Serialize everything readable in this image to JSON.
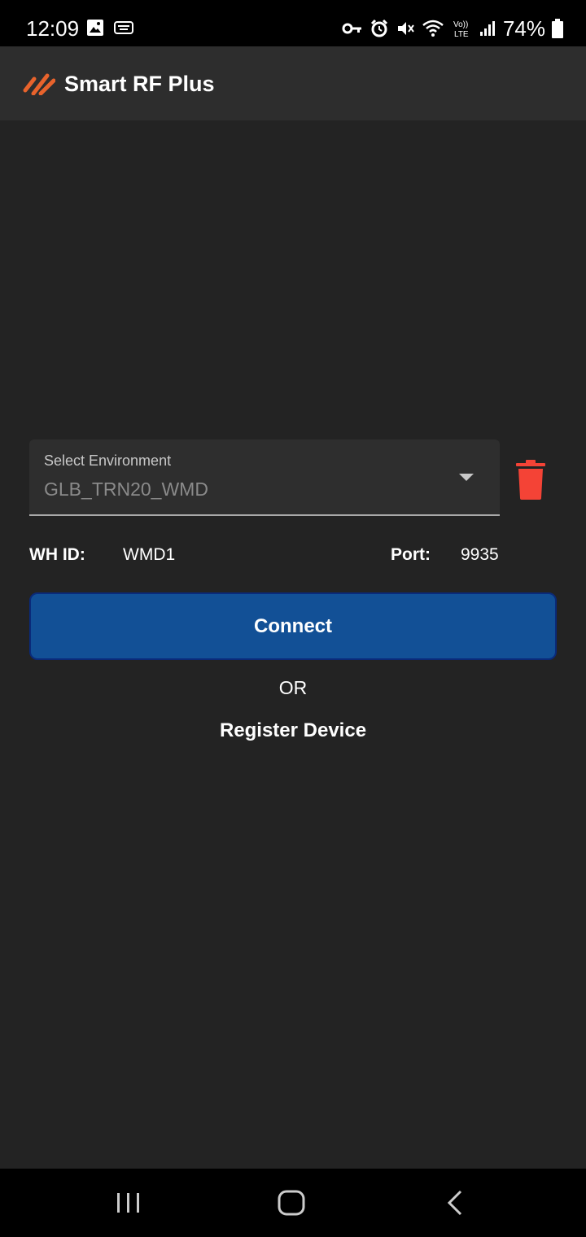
{
  "status_bar": {
    "time": "12:09",
    "battery": "74%",
    "left_icons": [
      "image-icon",
      "keyboard-icon"
    ],
    "right_icons": [
      "vpn-key-icon",
      "alarm-icon",
      "mute-icon",
      "wifi-icon",
      "volte-icon",
      "signal-icon",
      "battery-icon"
    ]
  },
  "app_bar": {
    "title": "Smart RF Plus",
    "logo_color": "#e8632c"
  },
  "environment": {
    "label": "Select Environment",
    "value": "GLB_TRN20_WMD"
  },
  "info": {
    "wh_id_label": "WH ID:",
    "wh_id_value": "WMD1",
    "port_label": "Port:",
    "port_value": "9935"
  },
  "actions": {
    "connect_label": "Connect",
    "or_text": "OR",
    "register_label": "Register Device"
  },
  "colors": {
    "primary": "#125096",
    "delete": "#f44336",
    "background": "#232323"
  }
}
